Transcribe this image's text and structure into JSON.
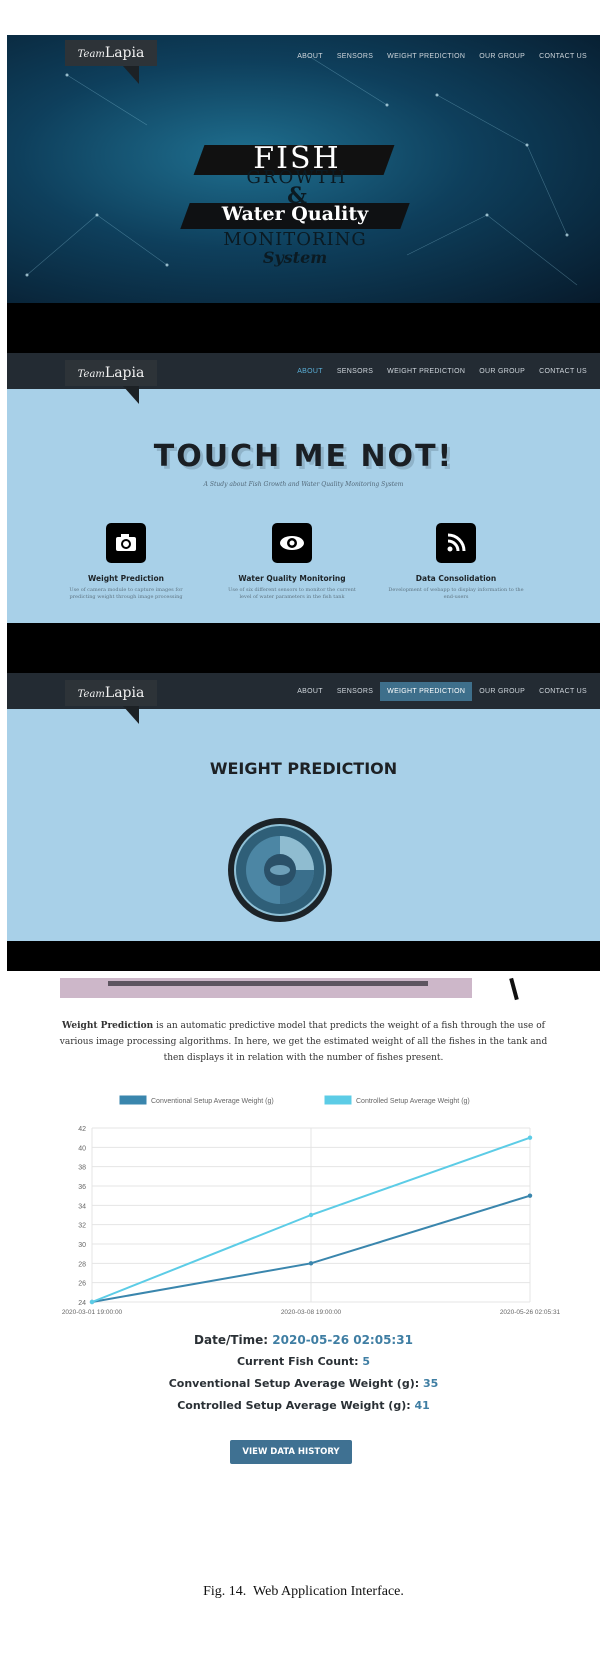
{
  "brand": {
    "prefix": "Team",
    "name": "Lapia"
  },
  "nav": [
    "ABOUT",
    "SENSORS",
    "WEIGHT PREDICTION",
    "OUR GROUP",
    "CONTACT US"
  ],
  "hero": {
    "line1": "FISH",
    "line2": "GROWTH",
    "line3": "&",
    "line4": "Water Quality",
    "line5": "MONITORING",
    "line6": "System"
  },
  "about": {
    "title": "TOUCH ME NOT!",
    "subtitle": "A Study about Fish Growth and Water Quality Monitoring System",
    "features": [
      {
        "icon": "camera-icon",
        "title": "Weight Prediction",
        "desc": "Use of camera module to capture images for predicting weight through image processing"
      },
      {
        "icon": "eye-icon",
        "title": "Water Quality Monitoring",
        "desc": "Use of six different sensors to monitor the current level of water parameters in the fish tank"
      },
      {
        "icon": "rss-icon",
        "title": "Data Consolidation",
        "desc": "Development of webapp to display information to the end-users"
      }
    ]
  },
  "weight": {
    "title": "WEIGHT PREDICTION"
  },
  "description": {
    "strong": "Weight Prediction",
    "rest": " is an automatic predictive model that predicts the weight of a fish through the use of various image processing algorithms. In here, we get the estimated weight of all the fishes in the tank and then displays it in relation with the number of fishes present."
  },
  "chart_data": {
    "type": "line",
    "x": [
      "2020-03-01 19:00:00",
      "2020-03-08 19:00:00",
      "2020-05-26 02:05:31"
    ],
    "series": [
      {
        "name": "Conventional Setup Average Weight (g)",
        "values": [
          24,
          28,
          35
        ],
        "color": "#3a86ad"
      },
      {
        "name": "Controlled Setup Average Weight (g)",
        "values": [
          24,
          33,
          41
        ],
        "color": "#5ccce6"
      }
    ],
    "ylim": [
      24,
      42
    ],
    "yticks": [
      24,
      26,
      28,
      30,
      32,
      34,
      36,
      38,
      40,
      42
    ],
    "grid": true,
    "legend": "top"
  },
  "stats": {
    "datetime_label": "Date/Time:",
    "datetime_value": "2020-05-26 02:05:31",
    "count_label": "Current Fish Count:",
    "count_value": "5",
    "conv_label": "Conventional Setup Average Weight (g):",
    "conv_value": "35",
    "ctrl_label": "Controlled Setup Average Weight (g):",
    "ctrl_value": "41"
  },
  "button": "VIEW DATA HISTORY",
  "caption": "Fig. 14.  Web Application Interface."
}
